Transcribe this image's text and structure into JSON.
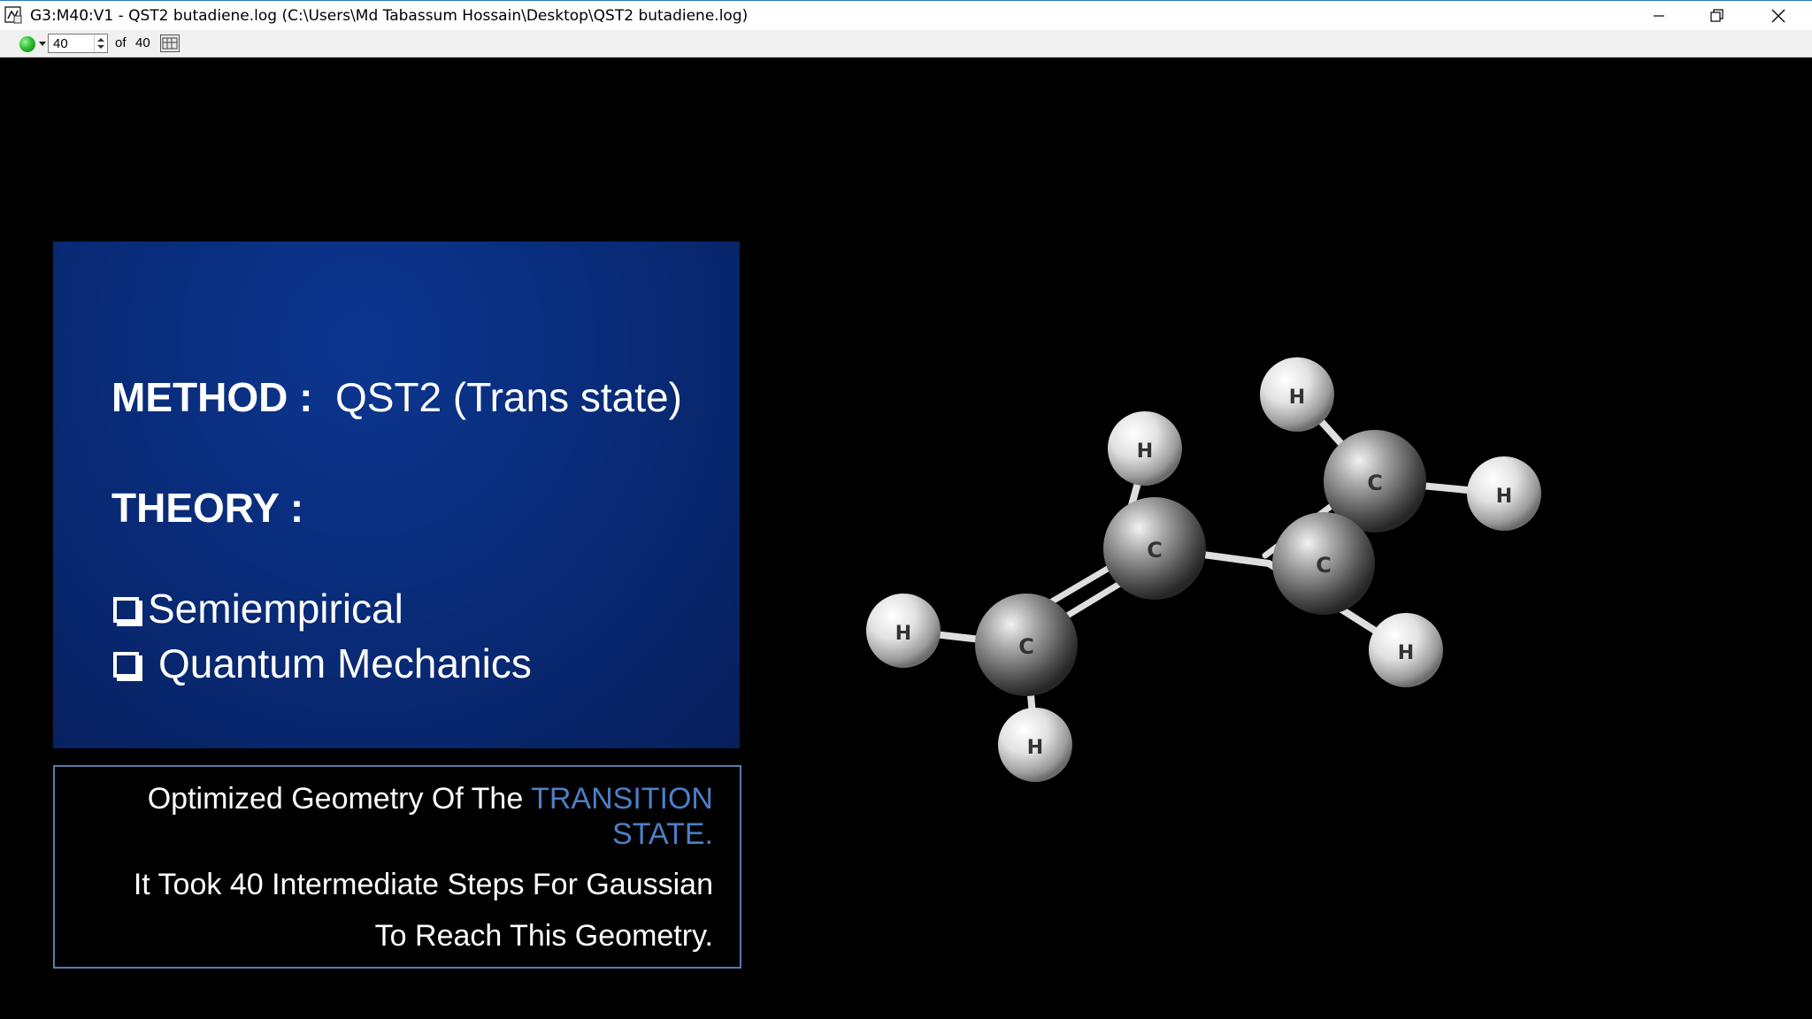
{
  "window": {
    "title": "G3:M40:V1 - QST2 butadiene.log (C:\\Users\\Md Tabassum Hossain\\Desktop\\QST2 butadiene.log)",
    "buttons": {
      "minimize": "minimize",
      "restore": "restore",
      "close": "close"
    }
  },
  "toolbar": {
    "frame_value": "40",
    "of_label": "of",
    "frame_total": "40"
  },
  "slide": {
    "method_label": "METHOD :",
    "method_value": "QST2 (Trans state)",
    "theory_label": "THEORY :",
    "theory_items": [
      "Semiempirical",
      "Quantum Mechanics"
    ],
    "info_line1_prefix": "Optimized Geometry Of The",
    "info_line1_highlight": "TRANSITION",
    "info_line2_highlight": "STATE.",
    "info_line3": "It Took 40 Intermediate Steps For Gaussian",
    "info_line4": "To Reach This Geometry.",
    "highlight_color": "#4d7fc6"
  },
  "molecule": {
    "name": "butadiene transition state",
    "atoms": [
      {
        "label": "H"
      },
      {
        "label": "C"
      },
      {
        "label": "H"
      },
      {
        "label": "C"
      },
      {
        "label": "H"
      },
      {
        "label": "C"
      },
      {
        "label": "H"
      },
      {
        "label": "C"
      },
      {
        "label": "H"
      },
      {
        "label": "H"
      }
    ]
  }
}
